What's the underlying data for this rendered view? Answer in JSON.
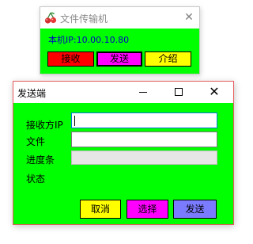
{
  "transfer_window": {
    "title": "文件传输机",
    "icon": "cherry-icon",
    "local_ip_text": "本机IP:10.00.10.80",
    "buttons": {
      "receive": "接收",
      "send": "发送",
      "about": "介绍"
    }
  },
  "sender_window": {
    "title": "发送端",
    "controls": {
      "minimize_icon": "minimize-icon",
      "maximize_icon": "maximize-icon",
      "close_icon": "close-icon"
    },
    "labels": {
      "receiver_ip": "接收方IP",
      "file": "文件",
      "progress": "进度条",
      "status": "状态"
    },
    "fields": {
      "receiver_ip_value": "",
      "file_value": ""
    },
    "progress_value": 0,
    "status_value": "",
    "buttons": {
      "cancel": "取消",
      "select": "选择",
      "send": "发送"
    }
  },
  "colors": {
    "client_background": "#00ff00",
    "receive_button": "#ff0000",
    "send_button_top": "#ff00ff",
    "about_button": "#ffff00",
    "cancel_button": "#ffff00",
    "select_button": "#ff00ff",
    "send_button_bottom": "#7b7bff",
    "ip_text": "#0000c0"
  }
}
